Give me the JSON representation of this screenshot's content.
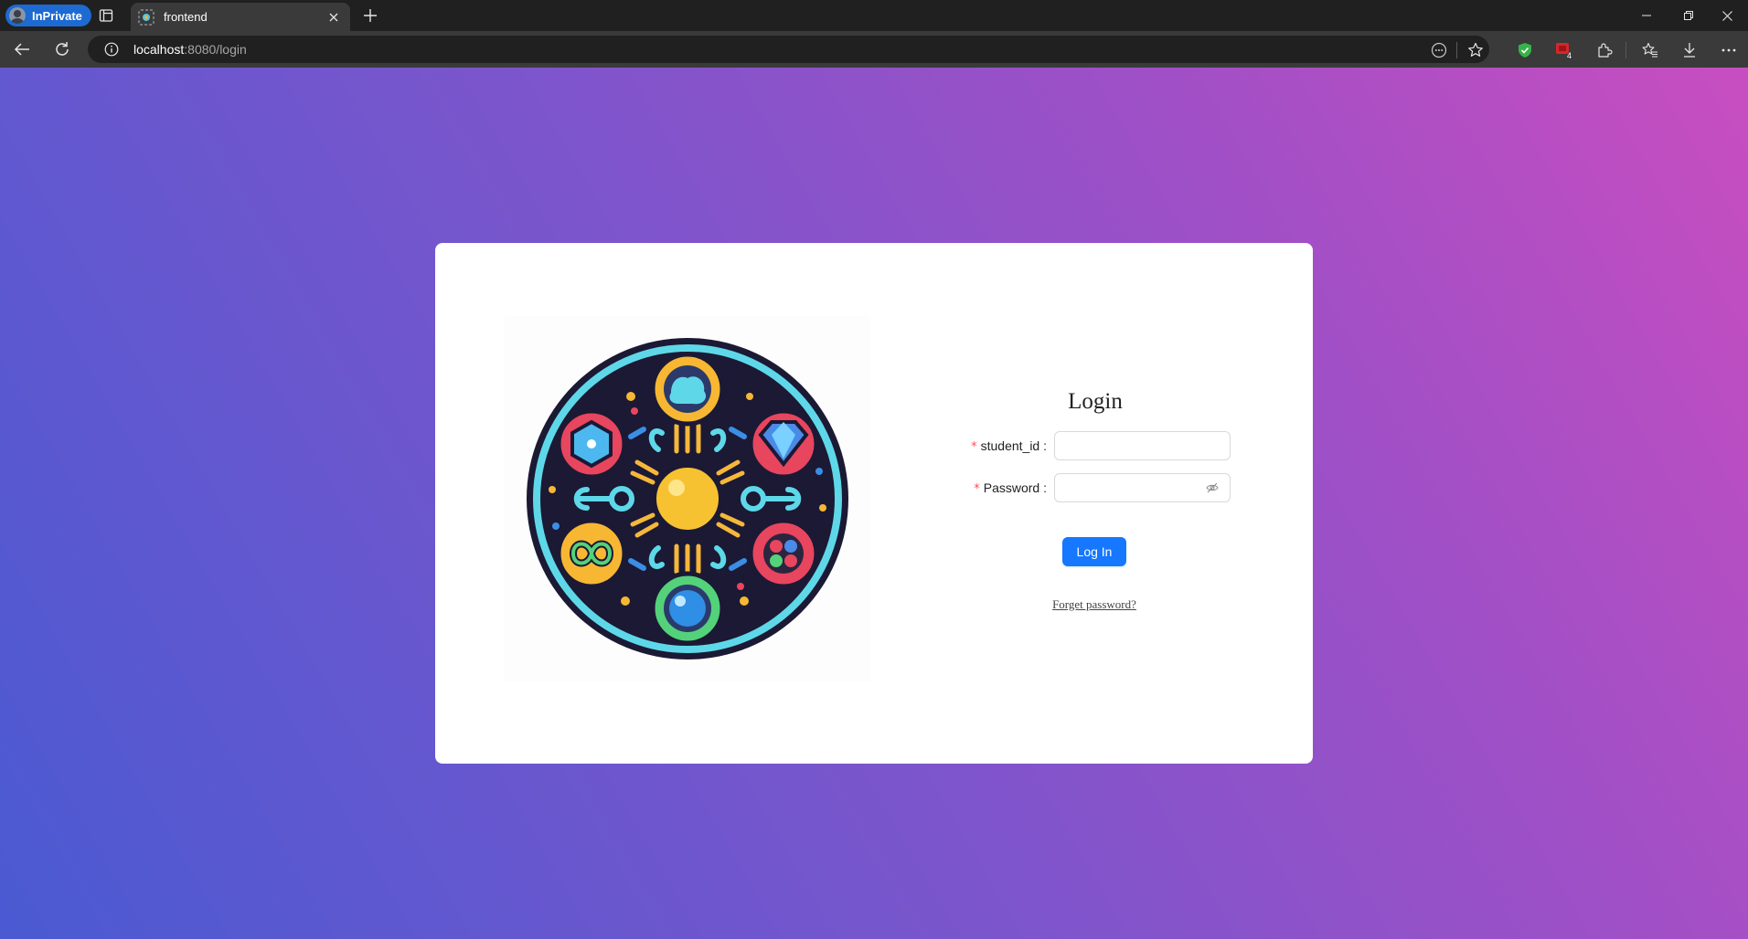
{
  "browser": {
    "profile_label": "InPrivate",
    "tab_title": "frontend",
    "url_host": "localhost",
    "url_rest": ":8080/login",
    "notification_badge": "4"
  },
  "login": {
    "title": "Login",
    "required_mark": "*",
    "student_id_label": "student_id :",
    "student_id_value": "",
    "password_label": "Password :",
    "password_value": "",
    "submit_label": "Log In",
    "forgot_label": "Forget password?"
  },
  "colors": {
    "primary": "#1677ff",
    "required": "#ff4d4f",
    "gradient_start": "#4a5ad2",
    "gradient_end": "#c84ec0"
  },
  "icons": [
    "profile-avatar-icon",
    "tab-actions-icon",
    "favicon-icon",
    "close-tab-icon",
    "new-tab-icon",
    "minimize-icon",
    "restore-icon",
    "close-window-icon",
    "back-icon",
    "refresh-icon",
    "site-info-icon",
    "reader-icon",
    "favorite-star-icon",
    "shield-extension-icon",
    "extension-badge-icon",
    "extensions-puzzle-icon",
    "favorites-icon",
    "download-icon",
    "more-icon",
    "eye-hidden-icon"
  ]
}
